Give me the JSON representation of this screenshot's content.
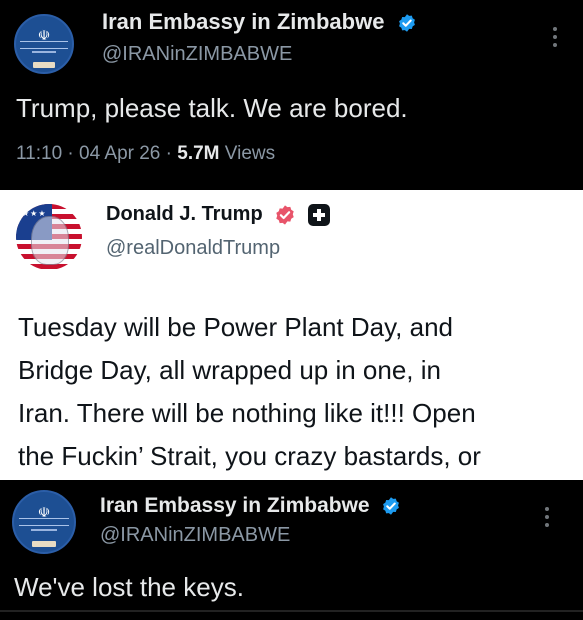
{
  "tweets": [
    {
      "author_name": "Iran Embassy in Zimbabwe",
      "handle": "@IRANinZIMBABWE",
      "text": "Trump, please talk. We are bored.",
      "time": "11:10",
      "date": "04 Apr 26",
      "views_count": "5.7M",
      "views_label": "Views"
    },
    {
      "author_name": "Donald J. Trump",
      "handle": "@realDonaldTrump",
      "lines": [
        "Tuesday will be Power Plant Day, and",
        "Bridge Day, all wrapped up in one, in",
        "Iran. There will be nothing like it!!! Open",
        "the Fuckin’ Strait, you crazy bastards, or"
      ]
    },
    {
      "author_name": "Iran Embassy in Zimbabwe",
      "handle": "@IRANinZIMBABWE",
      "text": "We've lost the keys."
    }
  ],
  "separators": {
    "dot1": "·",
    "dot2": "·"
  },
  "colors": {
    "verified_blue": "#1d9bf0",
    "trump_badge": "#e8546a",
    "dark_bg": "#000000",
    "light_bg": "#ffffff"
  },
  "icons": {
    "verified": "verified-badge-icon",
    "more": "more-options-icon",
    "affiliation": "affiliate-badge-icon"
  }
}
